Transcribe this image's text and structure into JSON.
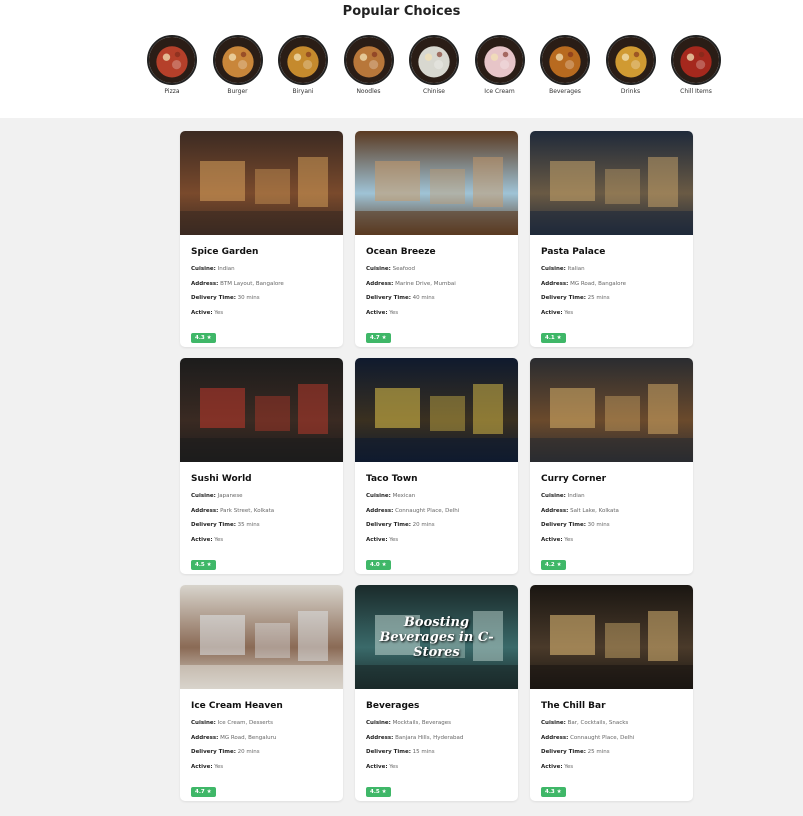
{
  "header": {
    "title": "Popular Choices"
  },
  "categories": [
    {
      "label": "Pizza",
      "icon": "pizza-icon",
      "color": "#b5402a"
    },
    {
      "label": "Burger",
      "icon": "burger-icon",
      "color": "#c9863a"
    },
    {
      "label": "Biryani",
      "icon": "biryani-icon",
      "color": "#c58a2d"
    },
    {
      "label": "Noodles",
      "icon": "noodles-icon",
      "color": "#b8773a"
    },
    {
      "label": "Chinise",
      "icon": "dumpling-icon",
      "color": "#d8d8d0"
    },
    {
      "label": "Ice Cream",
      "icon": "ice-cream-icon",
      "color": "#e7c5c8"
    },
    {
      "label": "Beverages",
      "icon": "beverage-icon",
      "color": "#b86a1f"
    },
    {
      "label": "Drinks",
      "icon": "beer-icon",
      "color": "#d09a32"
    },
    {
      "label": "Chill Items",
      "icon": "chilli-icon",
      "color": "#a5281d"
    }
  ],
  "field_labels": {
    "cuisine": "Cuisine:",
    "address": "Address:",
    "delivery": "Delivery Time:",
    "active": "Active:"
  },
  "restaurants": [
    {
      "name": "Spice Garden",
      "cuisine": "Indian",
      "address": "BTM Layout, Bangalore",
      "delivery": "30 mins",
      "active": "Yes",
      "rating": "4.3 ★",
      "image_colors": [
        "#3b2a22",
        "#7a4a2c",
        "#d9a35c"
      ]
    },
    {
      "name": "Ocean Breeze",
      "cuisine": "Seafood",
      "address": "Marine Drive, Mumbai",
      "delivery": "40 mins",
      "active": "Yes",
      "rating": "4.7 ★",
      "image_colors": [
        "#5a3a22",
        "#9fc3d6",
        "#c89a6a"
      ]
    },
    {
      "name": "Pasta Palace",
      "cuisine": "Italian",
      "address": "MG Road, Bangalore",
      "delivery": "25 mins",
      "active": "Yes",
      "rating": "4.1 ★",
      "image_colors": [
        "#1f2a3a",
        "#6a5a44",
        "#c9a66b"
      ]
    },
    {
      "name": "Sushi World",
      "cuisine": "Japanese",
      "address": "Park Street, Kolkata",
      "delivery": "35 mins",
      "active": "Yes",
      "rating": "4.5 ★",
      "image_colors": [
        "#1c1c1c",
        "#3a2a22",
        "#c0392b"
      ]
    },
    {
      "name": "Taco Town",
      "cuisine": "Mexican",
      "address": "Connaught Place, Delhi",
      "delivery": "20 mins",
      "active": "Yes",
      "rating": "4.0 ★",
      "image_colors": [
        "#0f1a2e",
        "#3a3020",
        "#e2c44a"
      ]
    },
    {
      "name": "Curry Corner",
      "cuisine": "Indian",
      "address": "Salt Lake, Kolkata",
      "delivery": "30 mins",
      "active": "Yes",
      "rating": "4.2 ★",
      "image_colors": [
        "#2a2c30",
        "#6b4a2c",
        "#d9b06a"
      ]
    },
    {
      "name": "Ice Cream Heaven",
      "cuisine": "Ice Cream, Desserts",
      "address": "MG Road, Bengaluru",
      "delivery": "20 mins",
      "active": "Yes",
      "rating": "4.7 ★",
      "image_colors": [
        "#d8d4cc",
        "#8a6a55",
        "#e0e6ea"
      ]
    },
    {
      "name": "Beverages",
      "cuisine": "Mocktails, Beverages",
      "address": "Banjara Hills, Hyderabad",
      "delivery": "15 mins",
      "active": "Yes",
      "rating": "4.5 ★",
      "image_colors": [
        "#1a2a2a",
        "#3a6a6a",
        "#c0d6d0"
      ],
      "image_caption": "Boosting Beverages in C-Stores"
    },
    {
      "name": "The Chill Bar",
      "cuisine": "Bar, Cocktails, Snacks",
      "address": "Connaught Place, Delhi",
      "delivery": "25 mins",
      "active": "Yes",
      "rating": "4.3 ★",
      "image_colors": [
        "#1a1612",
        "#4a3a2a",
        "#e6c079"
      ]
    }
  ]
}
